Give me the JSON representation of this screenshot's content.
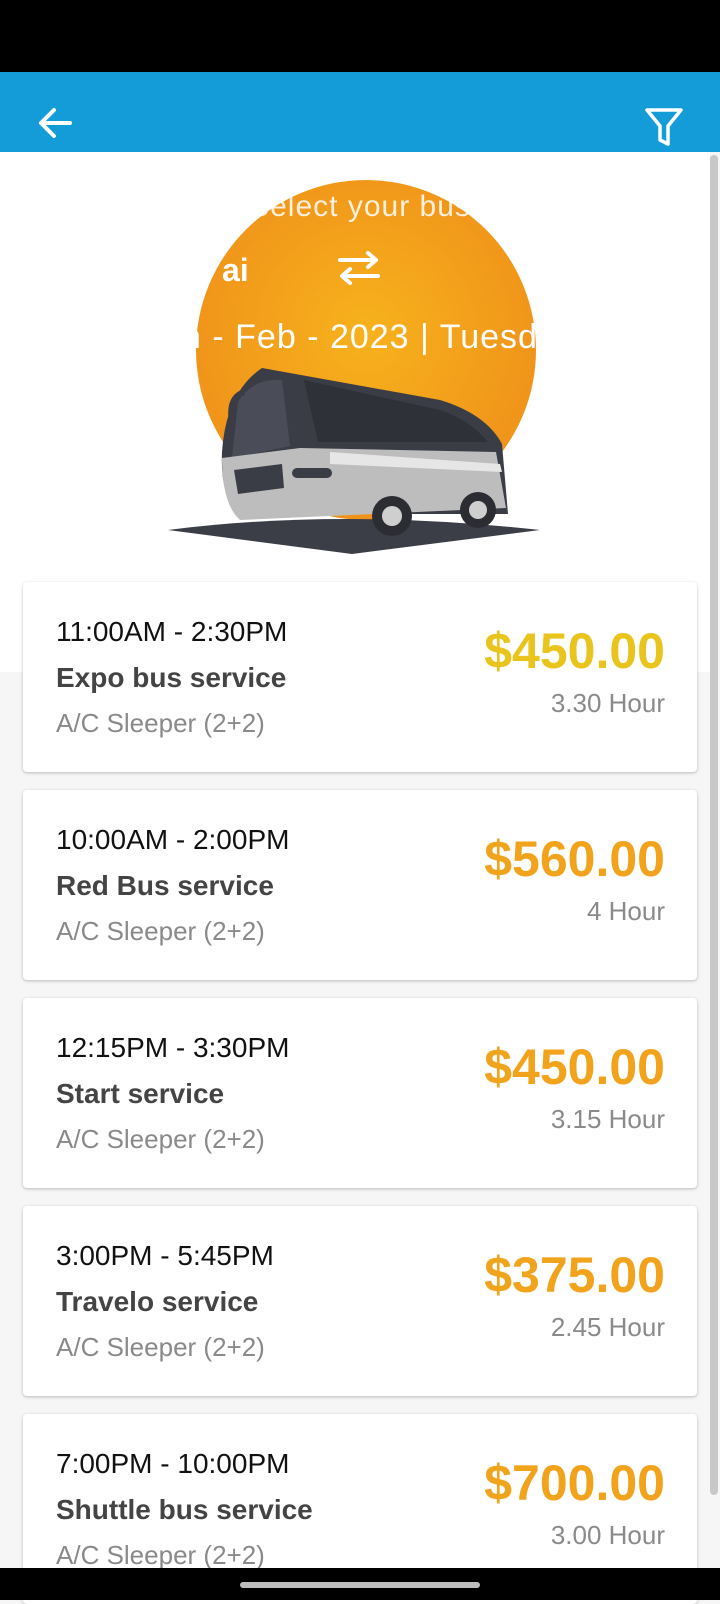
{
  "hero": {
    "subtitle_partial": "Select your bus",
    "city_partial": "ai",
    "date_partial": "n - Feb - 2023 | Tuesd"
  },
  "trips": [
    {
      "time": "11:00AM - 2:30PM",
      "name": "Expo bus service",
      "seat": "A/C Sleeper (2+2)",
      "price": "$450.00",
      "duration": "3.30 Hour"
    },
    {
      "time": "10:00AM - 2:00PM",
      "name": "Red Bus service",
      "seat": "A/C Sleeper (2+2)",
      "price": "$560.00",
      "duration": "4 Hour"
    },
    {
      "time": "12:15PM - 3:30PM",
      "name": "Start service",
      "seat": "A/C Sleeper (2+2)",
      "price": "$450.00",
      "duration": "3.15 Hour"
    },
    {
      "time": "3:00PM - 5:45PM",
      "name": "Travelo service",
      "seat": "A/C Sleeper (2+2)",
      "price": "$375.00",
      "duration": "2.45 Hour"
    },
    {
      "time": "7:00PM - 10:00PM",
      "name": "Shuttle bus service",
      "seat": "A/C Sleeper (2+2)",
      "price": "$700.00",
      "duration": "3.00 Hour"
    }
  ],
  "colors": {
    "app_bar": "#149cd8",
    "price": "#f2a31c",
    "price_highlight": "#e8c41c"
  }
}
